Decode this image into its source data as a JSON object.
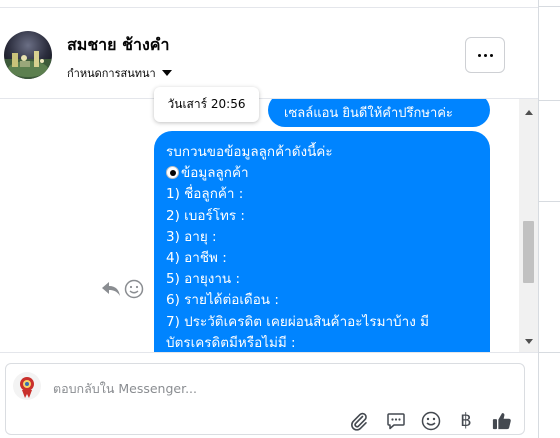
{
  "contact": {
    "name": "สมชาย ช้างคำ",
    "customize_label": "กำหนดการสนทนา"
  },
  "header": {
    "more_button_label": "More options"
  },
  "messages": {
    "top_bubble_text": "เซลล์แอน ยินดีให้คำปรึกษาค่ะ",
    "timestamp_tooltip": "วันเสาร์ 20:56",
    "main_bubble_lines": [
      "รบกวนขอข้อมูลลูกค้าดังนี้ค่ะ",
      "ข้อมูลลูกค้า",
      "1) ชื่อลูกค้า :",
      "2) เบอร์โทร :",
      "3) อายุ :",
      "4) อาชีพ :",
      "5) อายุงาน :",
      "6) รายได้ต่อเดือน :",
      "7) ประวัติเครดิต  เคยผ่อนสินค้าอะไรมาบ้าง มี",
      "บัตรเครดิตมีหรือไม่มี :"
    ]
  },
  "composer": {
    "placeholder": "ตอบกลับใน Messenger..."
  },
  "icons": {
    "reply": "reply-icon",
    "react": "smile-icon",
    "attach": "paperclip-icon",
    "gif": "chat-bubble-icon",
    "emoji": "smile-icon",
    "payment": "baht-icon",
    "like": "thumbs-up-icon"
  },
  "colors": {
    "bubble": "#0084ff",
    "bubble_text": "#ffffff",
    "placeholder": "#8a8d91",
    "icon": "#444950"
  }
}
